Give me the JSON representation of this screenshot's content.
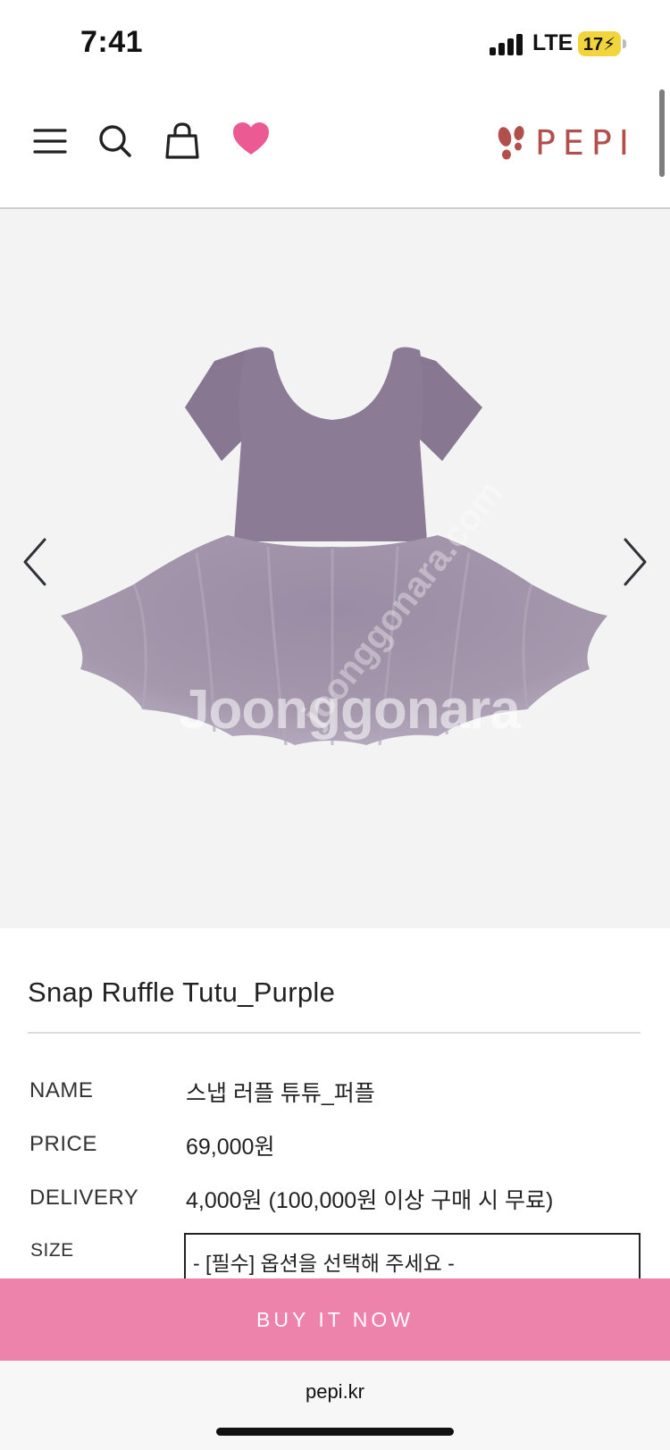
{
  "status_bar": {
    "time": "7:41",
    "network": "LTE",
    "battery": "17"
  },
  "header": {
    "icons": [
      "menu-icon",
      "search-icon",
      "shopping-bag-icon",
      "heart-icon"
    ],
    "logo_text": "PEPI",
    "brand_color": "#b24f4c",
    "heart_color": "#ec5a94"
  },
  "gallery": {
    "watermark": "Joonggonara",
    "watermark_diagonal": "joonggonara.com",
    "product_color": "#8a7a93"
  },
  "product": {
    "title": "Snap Ruffle Tutu_Purple",
    "rows": [
      {
        "label": "NAME",
        "value": "스냅 러플 튜튜_퍼플"
      },
      {
        "label": "PRICE",
        "value": "69,000원"
      },
      {
        "label": "DELIVERY",
        "value": "4,000원 (100,000원 이상 구매 시 무료)"
      }
    ],
    "size_label": "SIZE",
    "size_placeholder": "- [필수] 옵션을 선택해 주세요 -"
  },
  "buy": {
    "label": "BUY IT NOW",
    "color": "#ed82ab"
  },
  "browser": {
    "url": "pepi.kr"
  }
}
